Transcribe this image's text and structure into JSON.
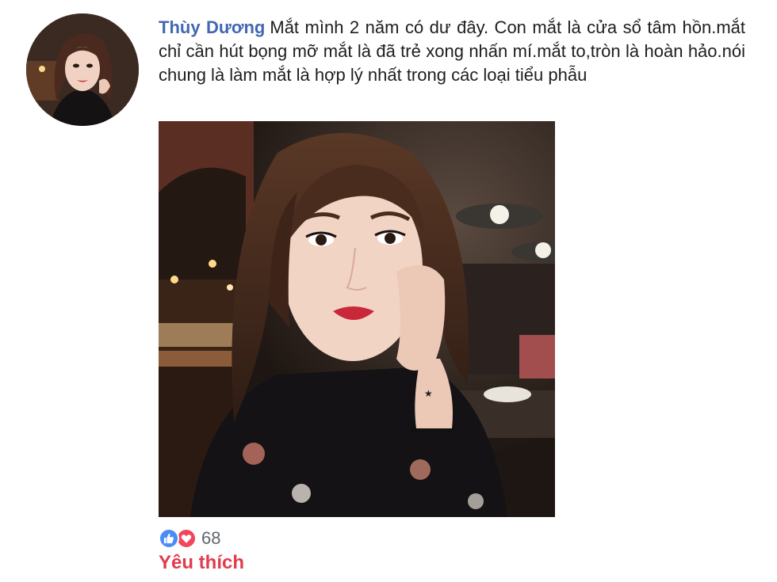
{
  "comment": {
    "author": "Thùy Dương",
    "text": "Mắt mình 2 năm có dư đây. Con mắt là cửa sổ tâm hồn.mắt chỉ cần hút bọng mỡ mắt là đã trẻ xong nhấn mí.mắt to,tròn là hoàn hảo.nói chung là làm mắt là hợp lý nhất trong các loại tiểu phẫu"
  },
  "reactions": {
    "icons": [
      "like-icon",
      "heart-icon"
    ],
    "count": "68",
    "like_color": "#4a8cf7",
    "love_color": "#f0475c"
  },
  "actions": {
    "like_label": "Yêu thích",
    "like_color": "#e23b4b"
  },
  "colors": {
    "author": "#4267b2",
    "text": "#1c1e21"
  }
}
